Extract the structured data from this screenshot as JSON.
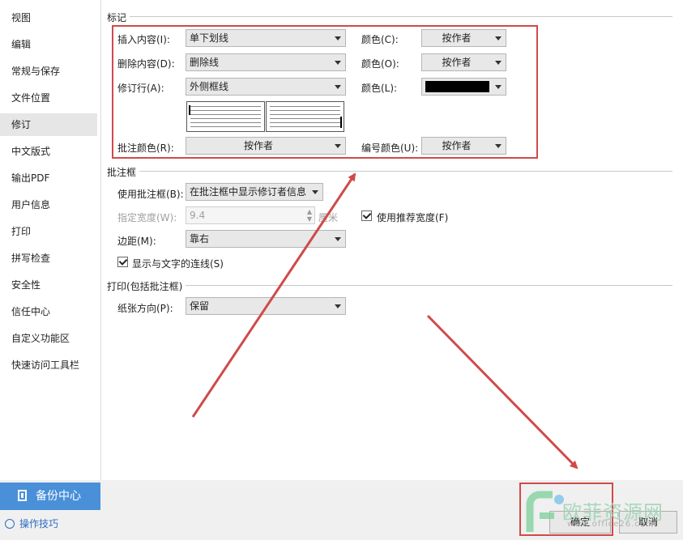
{
  "sidebar": {
    "items": [
      {
        "label": "视图"
      },
      {
        "label": "编辑"
      },
      {
        "label": "常规与保存"
      },
      {
        "label": "文件位置"
      },
      {
        "label": "修订"
      },
      {
        "label": "中文版式"
      },
      {
        "label": "输出PDF"
      },
      {
        "label": "用户信息"
      },
      {
        "label": "打印"
      },
      {
        "label": "拼写检查"
      },
      {
        "label": "安全性"
      },
      {
        "label": "信任中心"
      },
      {
        "label": "自定义功能区"
      },
      {
        "label": "快速访问工具栏"
      }
    ],
    "active": "修订",
    "backup_label": "备份中心",
    "tips_label": "操作技巧"
  },
  "markup": {
    "title": "标记",
    "insert_label": "插入内容(I):",
    "insert_value": "单下划线",
    "insert_color_label": "颜色(C):",
    "insert_color_value": "按作者",
    "delete_label": "删除内容(D):",
    "delete_value": "删除线",
    "delete_color_label": "颜色(O):",
    "delete_color_value": "按作者",
    "changed_line_label": "修订行(A):",
    "changed_line_value": "外侧框线",
    "changed_line_color_label": "颜色(L):",
    "changed_line_color": "#000000",
    "comment_color_label": "批注颜色(R):",
    "comment_color_value": "按作者",
    "number_color_label": "编号颜色(U):",
    "number_color_value": "按作者"
  },
  "balloons": {
    "title": "批注框",
    "use_label": "使用批注框(B):",
    "use_value": "在批注框中显示修订者信息",
    "width_label": "指定宽度(W):",
    "width_value": "9.4",
    "width_unit": "厘米",
    "recommended_label": "使用推荐宽度(F)",
    "recommended_checked": true,
    "margin_label": "边距(M):",
    "margin_value": "靠右",
    "show_lines_label": "显示与文字的连线(S)",
    "show_lines_checked": true
  },
  "print": {
    "title": "打印(包括批注框)",
    "orientation_label": "纸张方向(P):",
    "orientation_value": "保留"
  },
  "footer": {
    "ok_label": "确定",
    "cancel_label": "取消"
  },
  "watermark": {
    "text": "欧菲资源网",
    "url": "www.office26.com"
  },
  "colors": {
    "highlight": "#d04a4a",
    "arrow": "#d04a4a",
    "accent": "#4a90d9"
  }
}
